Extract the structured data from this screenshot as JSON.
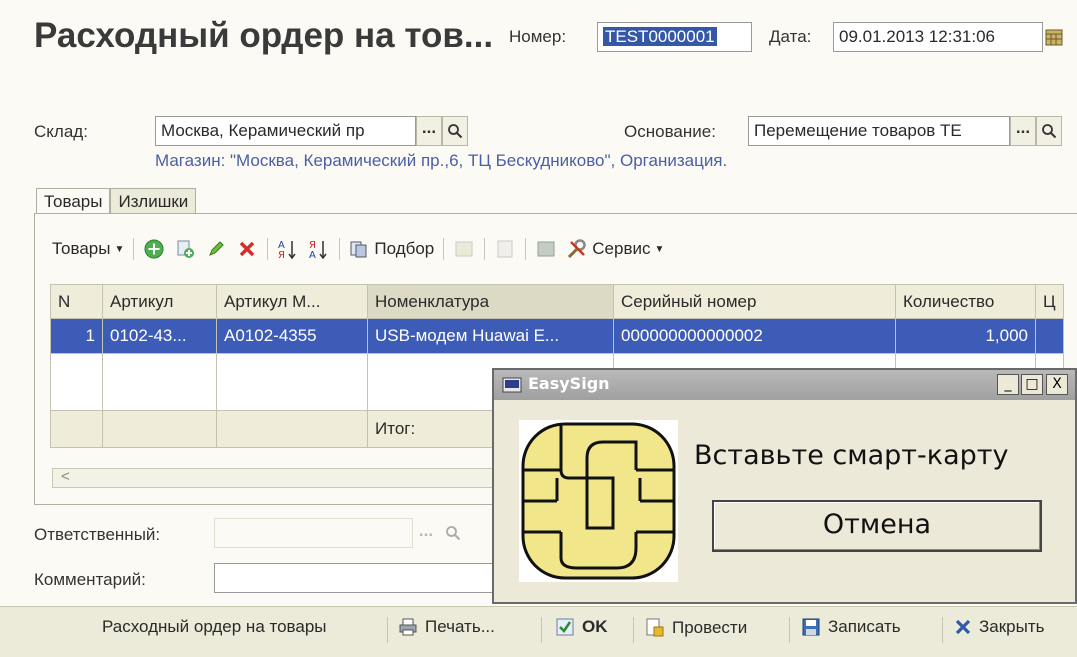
{
  "header": {
    "title": "Расходный ордер на тов...",
    "number_label": "Номер:",
    "number_value": "TEST0000001",
    "date_label": "Дата:",
    "date_value": "09.01.2013 12:31:06"
  },
  "form": {
    "warehouse_label": "Склад:",
    "warehouse_value": "Москва, Керамический пр",
    "warehouse_info": "Магазин: \"Москва, Керамический пр.,6, ТЦ Бескудниково\", Организация.",
    "basis_label": "Основание:",
    "basis_value": "Перемещение товаров ТЕ",
    "dots": "...",
    "responsible_label": "Ответственный:",
    "comment_label": "Комментарий:"
  },
  "tabs": [
    {
      "label": "Товары"
    },
    {
      "label": "Излишки"
    }
  ],
  "toolbar": {
    "goods_menu": "Товары",
    "pick_label": "Подбор",
    "service_label": "Сервис"
  },
  "grid": {
    "columns": [
      "N",
      "Артикул",
      "Артикул М...",
      "Номенклатура",
      "Серийный номер",
      "Количество",
      "Ц"
    ],
    "rows": [
      [
        "1",
        "0102-43...",
        "A0102-4355",
        "USB-модем Huawai E...",
        "000000000000002",
        "1,000",
        ""
      ]
    ],
    "total_label": "Итог:"
  },
  "bottom": {
    "doc_label": "Расходный ордер на товары",
    "print_label": "Печать...",
    "ok_label": "OK",
    "post_label": "Провести",
    "save_label": "Записать",
    "close_label": "Закрыть"
  },
  "dialog": {
    "title": "EasySign",
    "message": "Вставьте смарт-карту",
    "cancel_label": "Отмена",
    "minimize": "_",
    "maximize": "□",
    "close": "X"
  },
  "colors": {
    "selection": "#3d5cb8",
    "link": "#4a5fa5",
    "chip": "#f2e68a"
  }
}
